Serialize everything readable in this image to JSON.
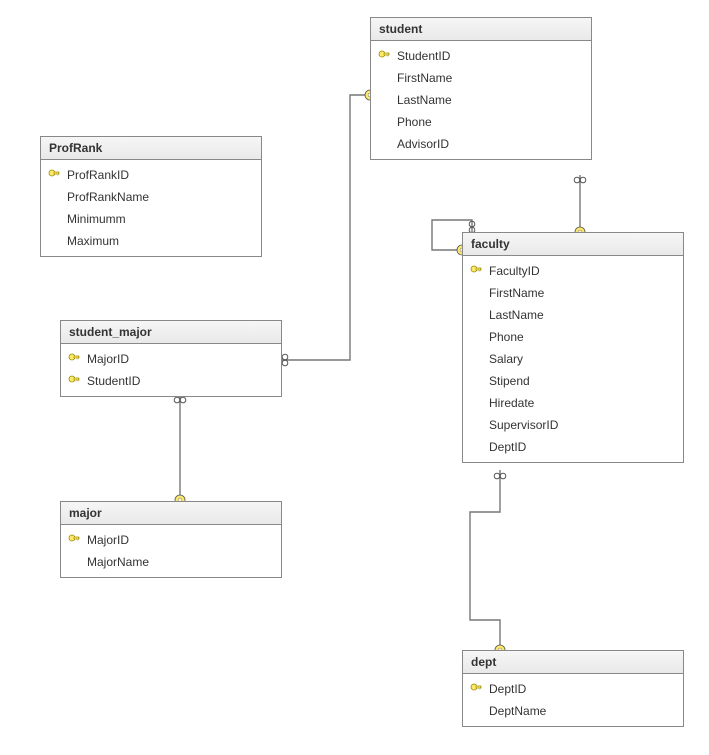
{
  "entities": {
    "profrank": {
      "title": "ProfRank",
      "columns": [
        {
          "name": "ProfRankID",
          "pk": true
        },
        {
          "name": "ProfRankName",
          "pk": false
        },
        {
          "name": "Minimumm",
          "pk": false
        },
        {
          "name": "Maximum",
          "pk": false
        }
      ]
    },
    "student": {
      "title": "student",
      "columns": [
        {
          "name": "StudentID",
          "pk": true
        },
        {
          "name": "FirstName",
          "pk": false
        },
        {
          "name": "LastName",
          "pk": false
        },
        {
          "name": "Phone",
          "pk": false
        },
        {
          "name": "AdvisorID",
          "pk": false
        }
      ]
    },
    "student_major": {
      "title": "student_major",
      "columns": [
        {
          "name": "MajorID",
          "pk": true
        },
        {
          "name": "StudentID",
          "pk": true
        }
      ]
    },
    "faculty": {
      "title": "faculty",
      "columns": [
        {
          "name": "FacultyID",
          "pk": true
        },
        {
          "name": "FirstName",
          "pk": false
        },
        {
          "name": "LastName",
          "pk": false
        },
        {
          "name": "Phone",
          "pk": false
        },
        {
          "name": "Salary",
          "pk": false
        },
        {
          "name": "Stipend",
          "pk": false
        },
        {
          "name": "Hiredate",
          "pk": false
        },
        {
          "name": "SupervisorID",
          "pk": false
        },
        {
          "name": "DeptID",
          "pk": false
        }
      ]
    },
    "major": {
      "title": "major",
      "columns": [
        {
          "name": "MajorID",
          "pk": true
        },
        {
          "name": "MajorName",
          "pk": false
        }
      ]
    },
    "dept": {
      "title": "dept",
      "columns": [
        {
          "name": "DeptID",
          "pk": true
        },
        {
          "name": "DeptName",
          "pk": false
        }
      ]
    }
  }
}
